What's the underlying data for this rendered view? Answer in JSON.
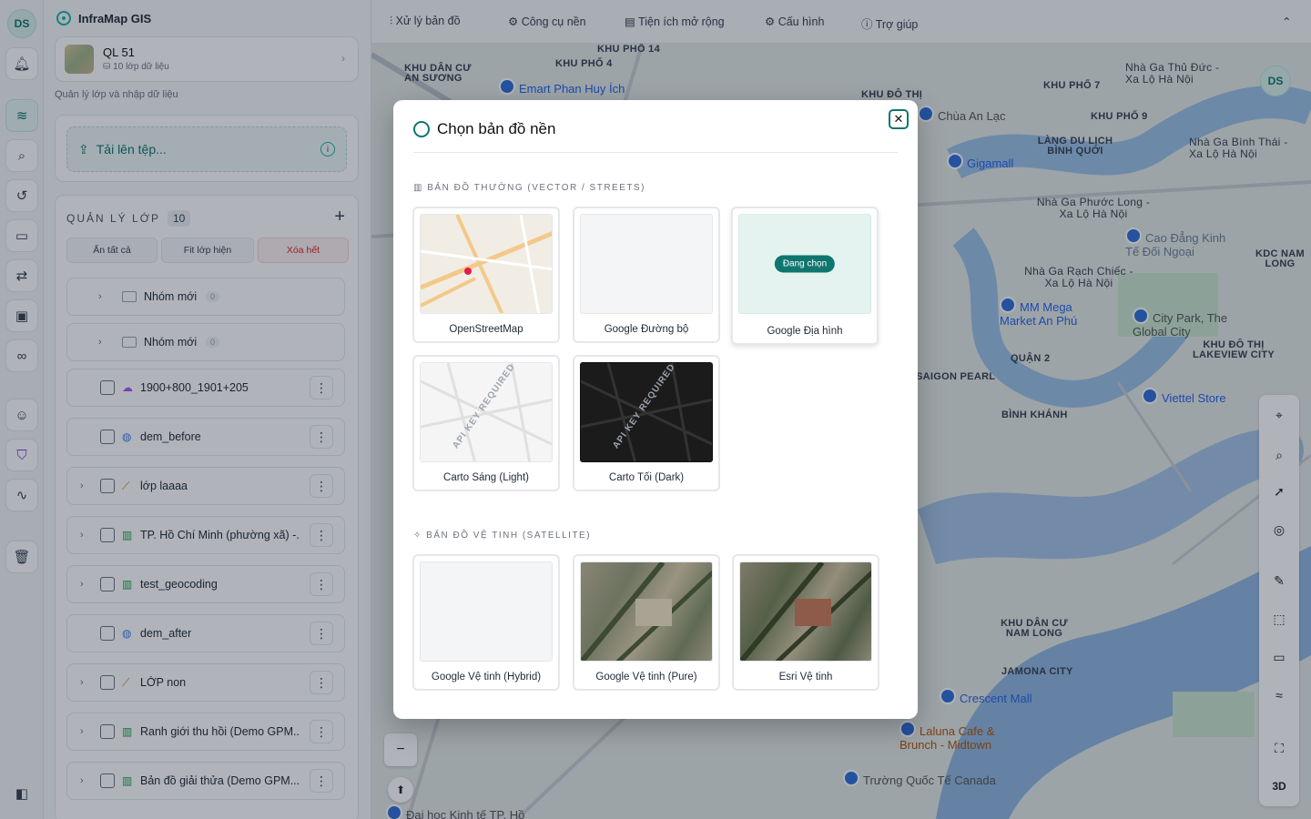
{
  "rail": {
    "avatar": "DS"
  },
  "panel": {
    "brand": "InfraMap GIS",
    "project_name": "QL 51",
    "project_sub": "10 lớp dữ liệu",
    "hint": "Quản lý lớp và nhập dữ liệu",
    "upload_label": "Tải lên tệp...",
    "layers_title": "QUẢN LÝ LỚP",
    "layers_count": "10",
    "btn_hide_all": "Ẩn tất cả",
    "btn_fit": "Fit lớp hiện",
    "btn_clear": "Xóa hết",
    "rows": [
      {
        "name": "Nhóm mới",
        "badge": "0",
        "type": "group"
      },
      {
        "name": "Nhóm mới",
        "badge": "0",
        "type": "group"
      },
      {
        "name": "1900+800_1901+205",
        "type": "layer",
        "icon": "cloud-icon"
      },
      {
        "name": "dem_before",
        "type": "layer",
        "icon": "globe-icon"
      },
      {
        "name": "lớp laaaa",
        "type": "layer",
        "icon": "ruler-icon"
      },
      {
        "name": "TP. Hồ Chí Minh (phường xã) -...",
        "type": "layer",
        "icon": "map-icon"
      },
      {
        "name": "test_geocoding",
        "type": "layer",
        "icon": "map-icon"
      },
      {
        "name": "dem_after",
        "type": "layer",
        "icon": "globe-icon"
      },
      {
        "name": "LỚP non",
        "type": "layer",
        "icon": "ruler-icon"
      },
      {
        "name": "Ranh giới thu hồi (Demo GPM...",
        "type": "layer",
        "icon": "map-icon"
      },
      {
        "name": "Bản đồ giải thửa (Demo GPM...",
        "type": "layer",
        "icon": "map-icon"
      }
    ]
  },
  "toolbar": {
    "items": [
      "Xử lý bản đồ",
      "Công cụ nền",
      "Tiện ích mở rộng",
      "Cấu hình",
      "Trợ giúp"
    ]
  },
  "map": {
    "avatar": "DS",
    "btn_3d": "3D",
    "zoom_out": "−",
    "labels": [
      "KHU PHỐ 14",
      "KHU DÂN CƯ AN SƯƠNG",
      "KHU PHỐ 4",
      "KHU ĐÔ THỊ",
      "KHU PHỐ 7",
      "Nhà Ga Thủ Đức - Xa Lộ Hà Nội",
      "KHU PHỐ 9",
      "LÀNG DU LỊCH BÌNH QUỚI",
      "Nhà Ga Bình Thái - Xa Lộ Hà Nội",
      "Nhà Ga Phước Long - Xa Lộ Hà Nội",
      "KDC NAM LONG",
      "Nhà Ga Rạch Chiếc - Xa Lộ Hà Nội",
      "QUẬN 2",
      "KHU ĐÔ THỊ LAKEVIEW CITY",
      "BÌNH KHÁNH",
      "KHU DÂN CƯ NAM LONG",
      "JAMONA CITY",
      "SAIGON PEARL"
    ],
    "pois": [
      "Emart Phan Huy Ích",
      "Chùa An Lạc",
      "Gigamall",
      "Cao Đẳng Kinh Tế Đối Ngoại",
      "MM Mega Market An Phú",
      "City Park, The Global City",
      "Viettel Store",
      "Crescent Mall",
      "Laluna Cafe & Brunch - Midtown",
      "Trường Quốc Tế Canada",
      "Đại học Kinh tế TP. Hồ"
    ]
  },
  "modal": {
    "title": "Chọn bản đồ nền",
    "section_vector": "BẢN ĐỒ THƯỜNG (VECTOR / STREETS)",
    "section_sat": "BẢN ĐỒ VỆ TINH (SATELLITE)",
    "selected_pill": "Đang chọn",
    "watermark": "API KEY REQUIRED",
    "vector": [
      "OpenStreetMap",
      "Google Đường bộ",
      "Google Địa hình",
      "Carto Sáng (Light)",
      "Carto Tối (Dark)"
    ],
    "satellite": [
      "Google Vệ tinh (Hybrid)",
      "Google Vệ tinh (Pure)",
      "Esri Vệ tinh"
    ]
  },
  "colors": {
    "accent": "#0f766e",
    "danger": "#dc2626"
  }
}
